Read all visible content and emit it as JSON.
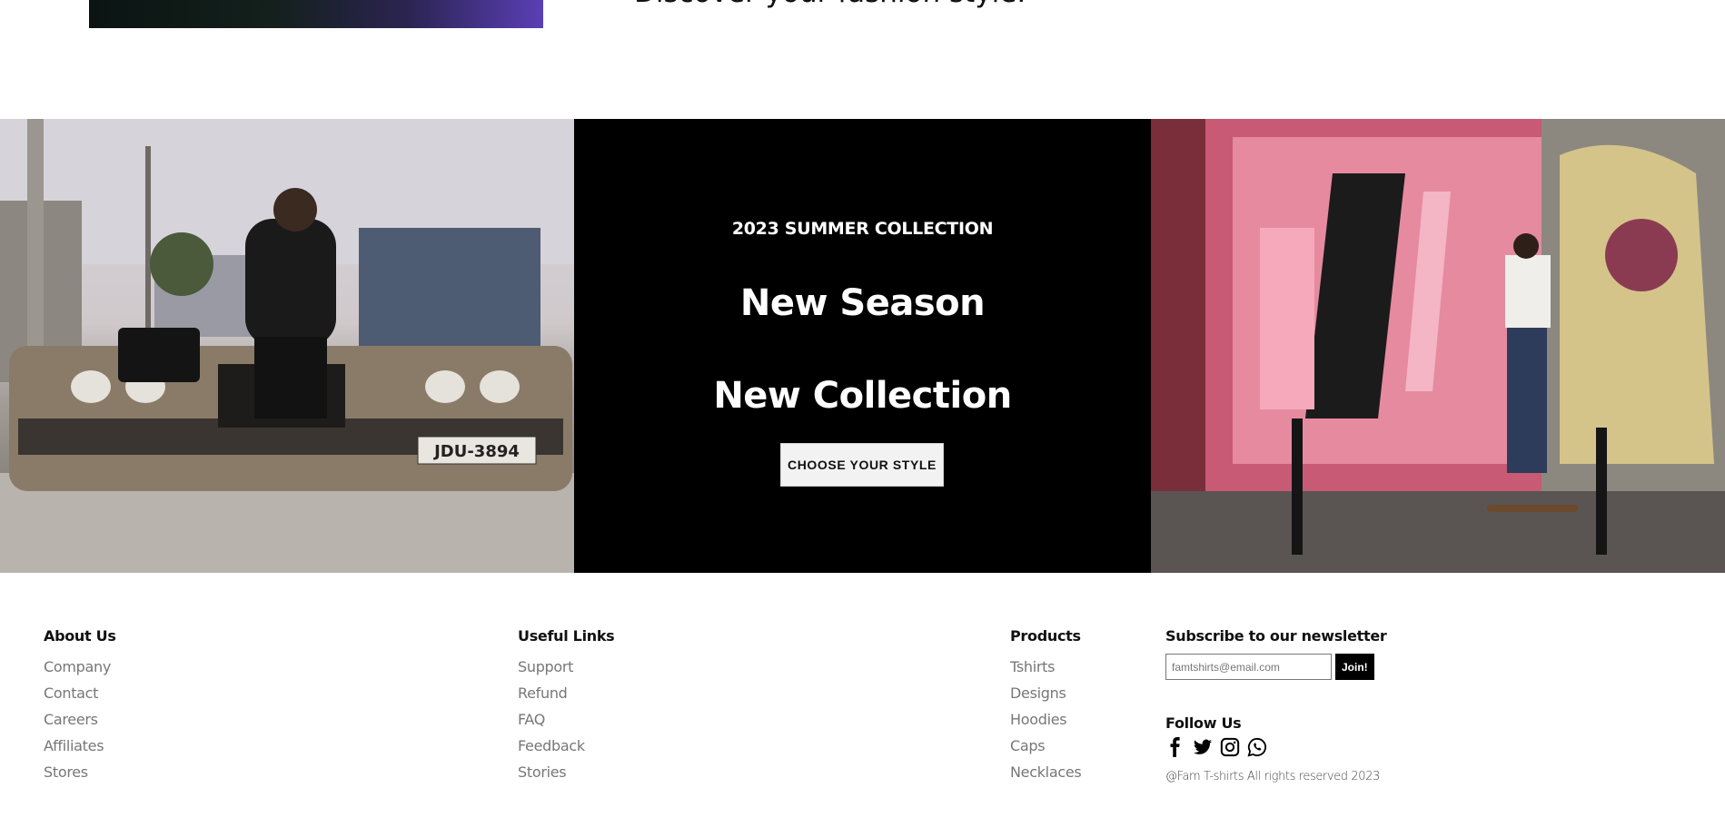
{
  "top": {
    "heading": "Discover your fashion style."
  },
  "banner": {
    "eyebrow": "2023 SUMMER COLLECTION",
    "headline_1": "New Season",
    "headline_2": "New Collection",
    "cta_label": "CHOOSE YOUR STYLE",
    "left_photo_plate": "JDU-3894"
  },
  "footer": {
    "about": {
      "title": "About Us",
      "links": [
        "Company",
        "Contact",
        "Careers",
        "Affiliates",
        "Stores"
      ]
    },
    "useful": {
      "title": "Useful Links",
      "links": [
        "Support",
        "Refund",
        "FAQ",
        "Feedback",
        "Stories"
      ]
    },
    "products": {
      "title": "Products",
      "links": [
        "Tshirts",
        "Designs",
        "Hoodies",
        "Caps",
        "Necklaces"
      ]
    },
    "newsletter": {
      "title": "Subscribe to our newsletter",
      "placeholder": "famtshirts@email.com",
      "button": "Join!"
    },
    "follow": {
      "title": "Follow Us",
      "icons": [
        "facebook-icon",
        "twitter-icon",
        "instagram-icon",
        "whatsapp-icon"
      ]
    },
    "copyright": "@Fam T-shirts All rights reserved 2023"
  }
}
